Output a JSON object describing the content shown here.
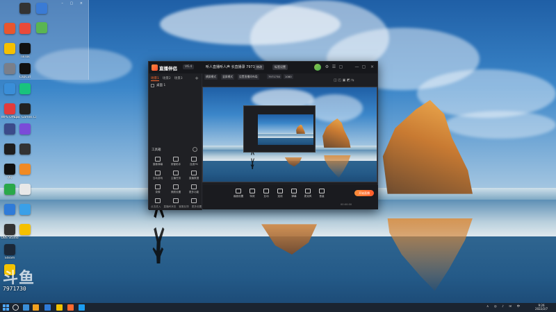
{
  "desktop": {
    "folder_window_controls": "– ▢ ×",
    "icons_col1": [
      {
        "label": "",
        "color": "#e8562e"
      },
      {
        "label": "",
        "color": "#f5c000"
      },
      {
        "label": "",
        "color": "#7a7f8a"
      },
      {
        "label": "",
        "color": "#3a8ed8"
      },
      {
        "label": "WPS Office",
        "color": "#e23b3b"
      },
      {
        "label": "",
        "color": "#3b4b8a"
      },
      {
        "label": "",
        "color": "#1e1e1e"
      },
      {
        "label": "QQ",
        "color": "#111111"
      },
      {
        "label": "",
        "color": "#2aa84a"
      },
      {
        "label": "",
        "color": "#2f7bd8"
      },
      {
        "label": "OBS Studio",
        "color": "#333333"
      },
      {
        "label": "Steam",
        "color": "#1b2838"
      },
      {
        "label": "",
        "color": "#f2c200"
      }
    ],
    "icons_col2": [
      {
        "label": "",
        "color": "#333333"
      },
      {
        "label": "",
        "color": "#e84a3a"
      },
      {
        "label": "TikTok",
        "color": "#111111"
      },
      {
        "label": "CapCut",
        "color": "#111111"
      },
      {
        "label": "",
        "color": "#19c37d"
      },
      {
        "label": "Epic Games Launcher",
        "color": "#222222"
      },
      {
        "label": "",
        "color": "#7b4bd8"
      },
      {
        "label": "",
        "color": "#333333"
      },
      {
        "label": "",
        "color": "#f08a24"
      },
      {
        "label": "",
        "color": "#e8e8e8"
      },
      {
        "label": "",
        "color": "#3aa0e8"
      },
      {
        "label": "",
        "color": "#f5c000"
      }
    ],
    "icons_col3": [
      {
        "label": "",
        "color": "#3a7bd5"
      },
      {
        "label": "",
        "color": "#5ab552"
      }
    ]
  },
  "watermark": {
    "logo": "斗鱼",
    "room_id": "7971730"
  },
  "app": {
    "name": "直播伴侣",
    "version": "V6.4",
    "stream_title": "听人直播听人声 长直播录 7971730",
    "badges": [
      "修改",
      "标签设置"
    ],
    "controls": [
      "⚙",
      "☰",
      "▢",
      "—",
      "▢",
      "×"
    ],
    "sidebar": {
      "tabs": [
        "场景1",
        "场景2",
        "场景3"
      ],
      "add_symbol": "+",
      "scene_item": "桌面 1",
      "tools_header": "工具箱",
      "tools": [
        "摄像弹幕",
        "房管助手",
        "连麦PK",
        "互动游戏",
        "主播任务",
        "直播数据",
        "录像",
        "美颜设置",
        "更多功能",
        "",
        "",
        ""
      ],
      "bottom_links": [
        "点击进入",
        "直播间状态",
        "客服反馈",
        "更多设置"
      ]
    },
    "top_row": [
      "横屏模式",
      "竖屏模式",
      "设置直播间布局",
      "7971730",
      "1080"
    ],
    "bottom_bar": {
      "items": [
        "画面设置",
        "特效",
        "互动",
        "连线",
        "弹幕",
        "麦克风",
        "音量"
      ],
      "go_live": "开始直播",
      "status": "00:00:00"
    }
  },
  "taskbar": {
    "tray_icons": "∧ ◎ ♪ ✉ 中",
    "time": "9:26",
    "date": "2022/2/7"
  }
}
